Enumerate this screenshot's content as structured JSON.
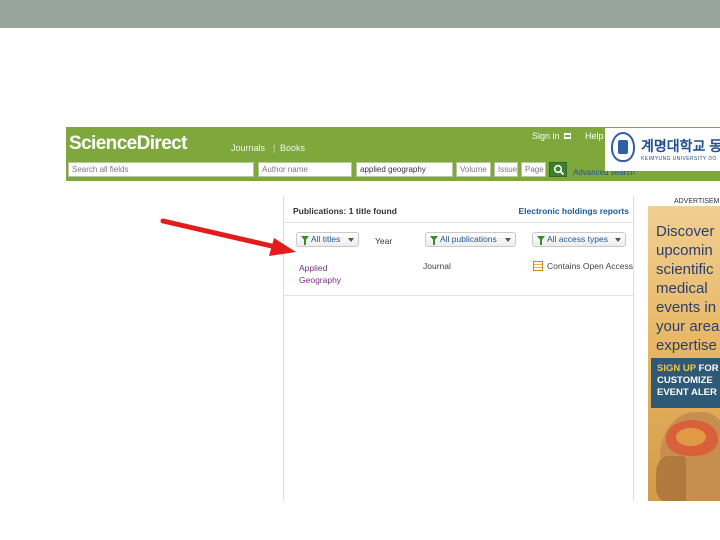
{
  "header": {
    "logo": "ScienceDirect",
    "nav": [
      "Journals",
      "|",
      "Books"
    ],
    "sign_in": "Sign in",
    "help": "Help",
    "search": {
      "all_fields_placeholder": "Search all fields",
      "author_placeholder": "Author name",
      "journal_value": "applied geography",
      "volume_placeholder": "Volume",
      "issue_placeholder": "Issue",
      "page_placeholder": "Page"
    },
    "advanced_search": "Advanced search",
    "university": {
      "name": "계명대학교 동",
      "sub": "KEIMYUNG UNIVERSITY DO"
    }
  },
  "results": {
    "title": "Publications: 1 title found",
    "holdings_link": "Electronic holdings reports",
    "filters": {
      "titles": "All titles",
      "year": "Year",
      "publications": "All publications",
      "access": "All access types"
    },
    "rows": [
      {
        "title": "Applied Geography",
        "type": "Journal",
        "access": "Contains Open Access"
      }
    ]
  },
  "ad": {
    "label": "ADVERTISEM",
    "text": "Discover\nupcomin\nscientific\nmedical\nevents in\nyour area\nexpertise",
    "cta_hl": "SIGN UP",
    "cta_rest": " FOR\nCUSTOMIZE\nEVENT ALER"
  },
  "colors": {
    "header_green": "#7ea73c",
    "link_blue": "#1c5a96",
    "visited_purple": "#7b2d86",
    "arrow_red": "#e31b1b",
    "slide_bar": "#97a69d"
  }
}
